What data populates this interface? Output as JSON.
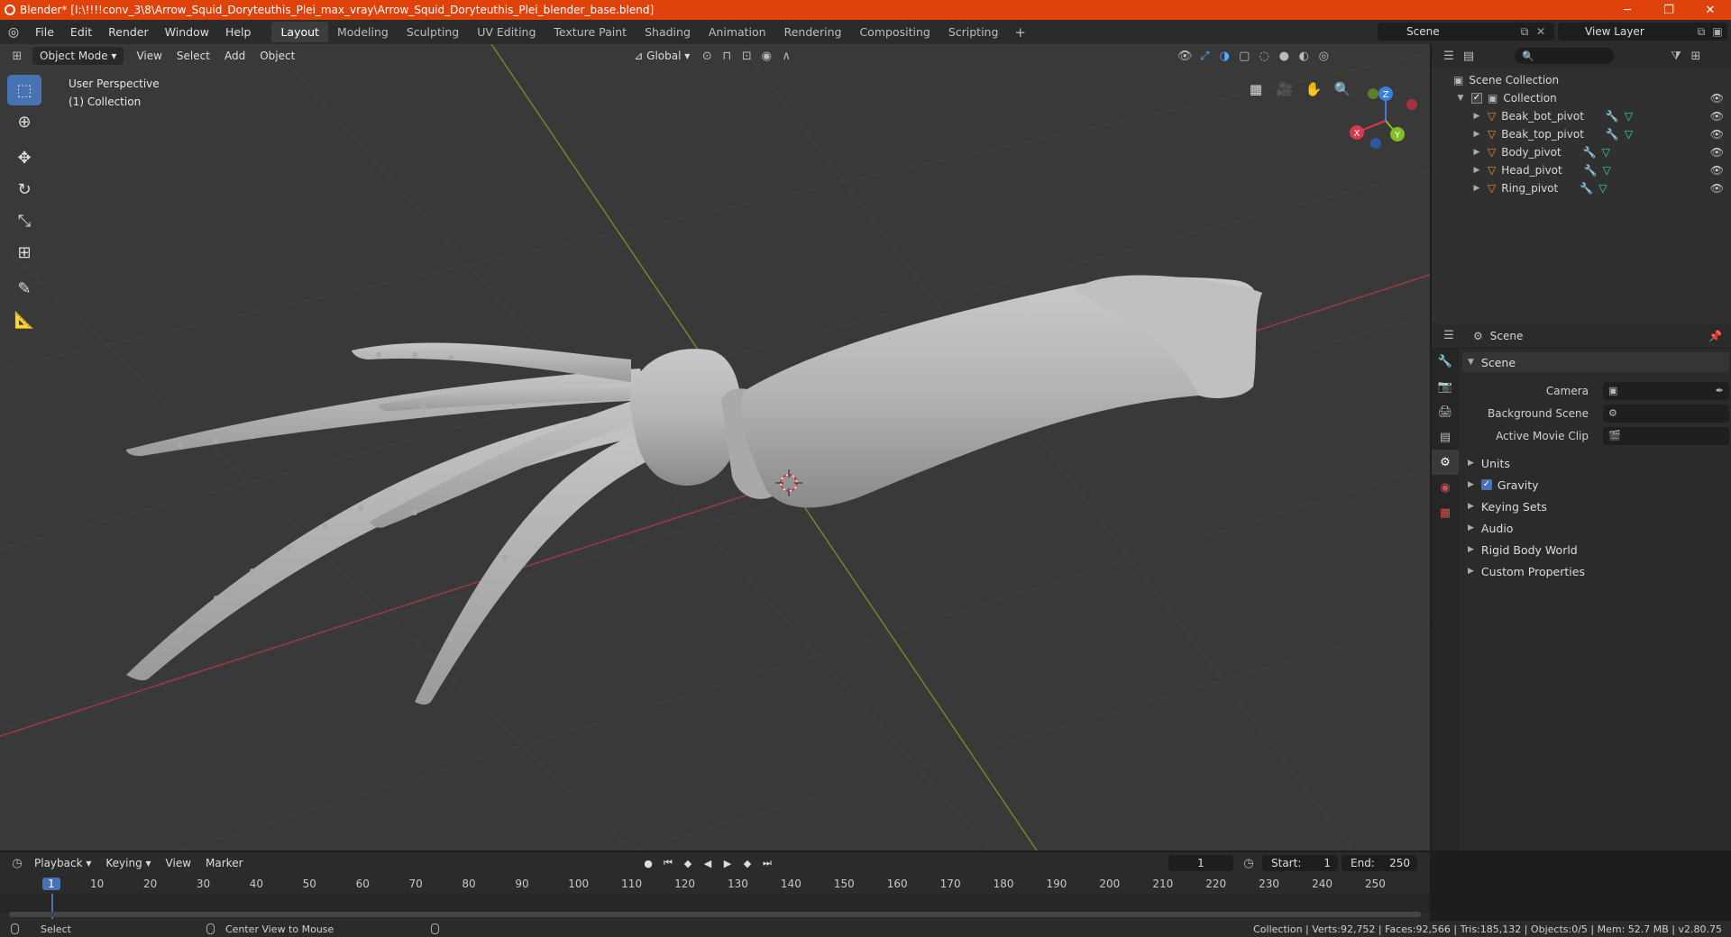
{
  "window": {
    "title": "Blender* [I:\\!!!!conv_3\\8\\Arrow_Squid_Doryteuthis_Plei_max_vray\\Arrow_Squid_Doryteuthis_Plei_blender_base.blend]",
    "minimize": "─",
    "maximize": "❐",
    "close": "✕"
  },
  "menubar": {
    "menus": [
      "File",
      "Edit",
      "Render",
      "Window",
      "Help"
    ],
    "workspaces": [
      "Layout",
      "Modeling",
      "Sculpting",
      "UV Editing",
      "Texture Paint",
      "Shading",
      "Animation",
      "Rendering",
      "Compositing",
      "Scripting"
    ],
    "active_workspace": "Layout",
    "add_tab": "+",
    "scene": "Scene",
    "view_layer": "View Layer"
  },
  "viewport": {
    "mode": "Object Mode",
    "menus": [
      "View",
      "Select",
      "Add",
      "Object"
    ],
    "transform_orientation": "Global",
    "info_line1": "User Perspective",
    "info_line2": "(1) Collection",
    "gizmo": {
      "x": "X",
      "y": "Y",
      "z": "Z"
    }
  },
  "outliner": {
    "root": "Scene Collection",
    "collection": "Collection",
    "objects": [
      "Beak_bot_pivot",
      "Beak_top_pivot",
      "Body_pivot",
      "Head_pivot",
      "Ring_pivot"
    ]
  },
  "properties": {
    "context": "Scene",
    "panel": "Scene",
    "camera_label": "Camera",
    "background_scene_label": "Background Scene",
    "active_movie_clip_label": "Active Movie Clip",
    "subpanels": [
      "Units",
      "Gravity",
      "Keying Sets",
      "Audio",
      "Rigid Body World",
      "Custom Properties"
    ]
  },
  "timeline": {
    "menus": [
      "Playback",
      "Keying",
      "View",
      "Marker"
    ],
    "current_frame": "1",
    "start_label": "Start:",
    "start": "1",
    "end_label": "End:",
    "end": "250",
    "ticks": [
      "1",
      "10",
      "20",
      "30",
      "40",
      "50",
      "60",
      "70",
      "80",
      "90",
      "100",
      "110",
      "120",
      "130",
      "140",
      "150",
      "160",
      "170",
      "180",
      "190",
      "200",
      "210",
      "220",
      "230",
      "240",
      "250"
    ]
  },
  "statusbar": {
    "select": "Select",
    "center_view": "Center View to Mouse",
    "stats": "Collection | Verts:92,752 | Faces:92,566 | Tris:185,132 | Objects:0/5 | Mem: 52.7 MB | v2.80.75"
  }
}
